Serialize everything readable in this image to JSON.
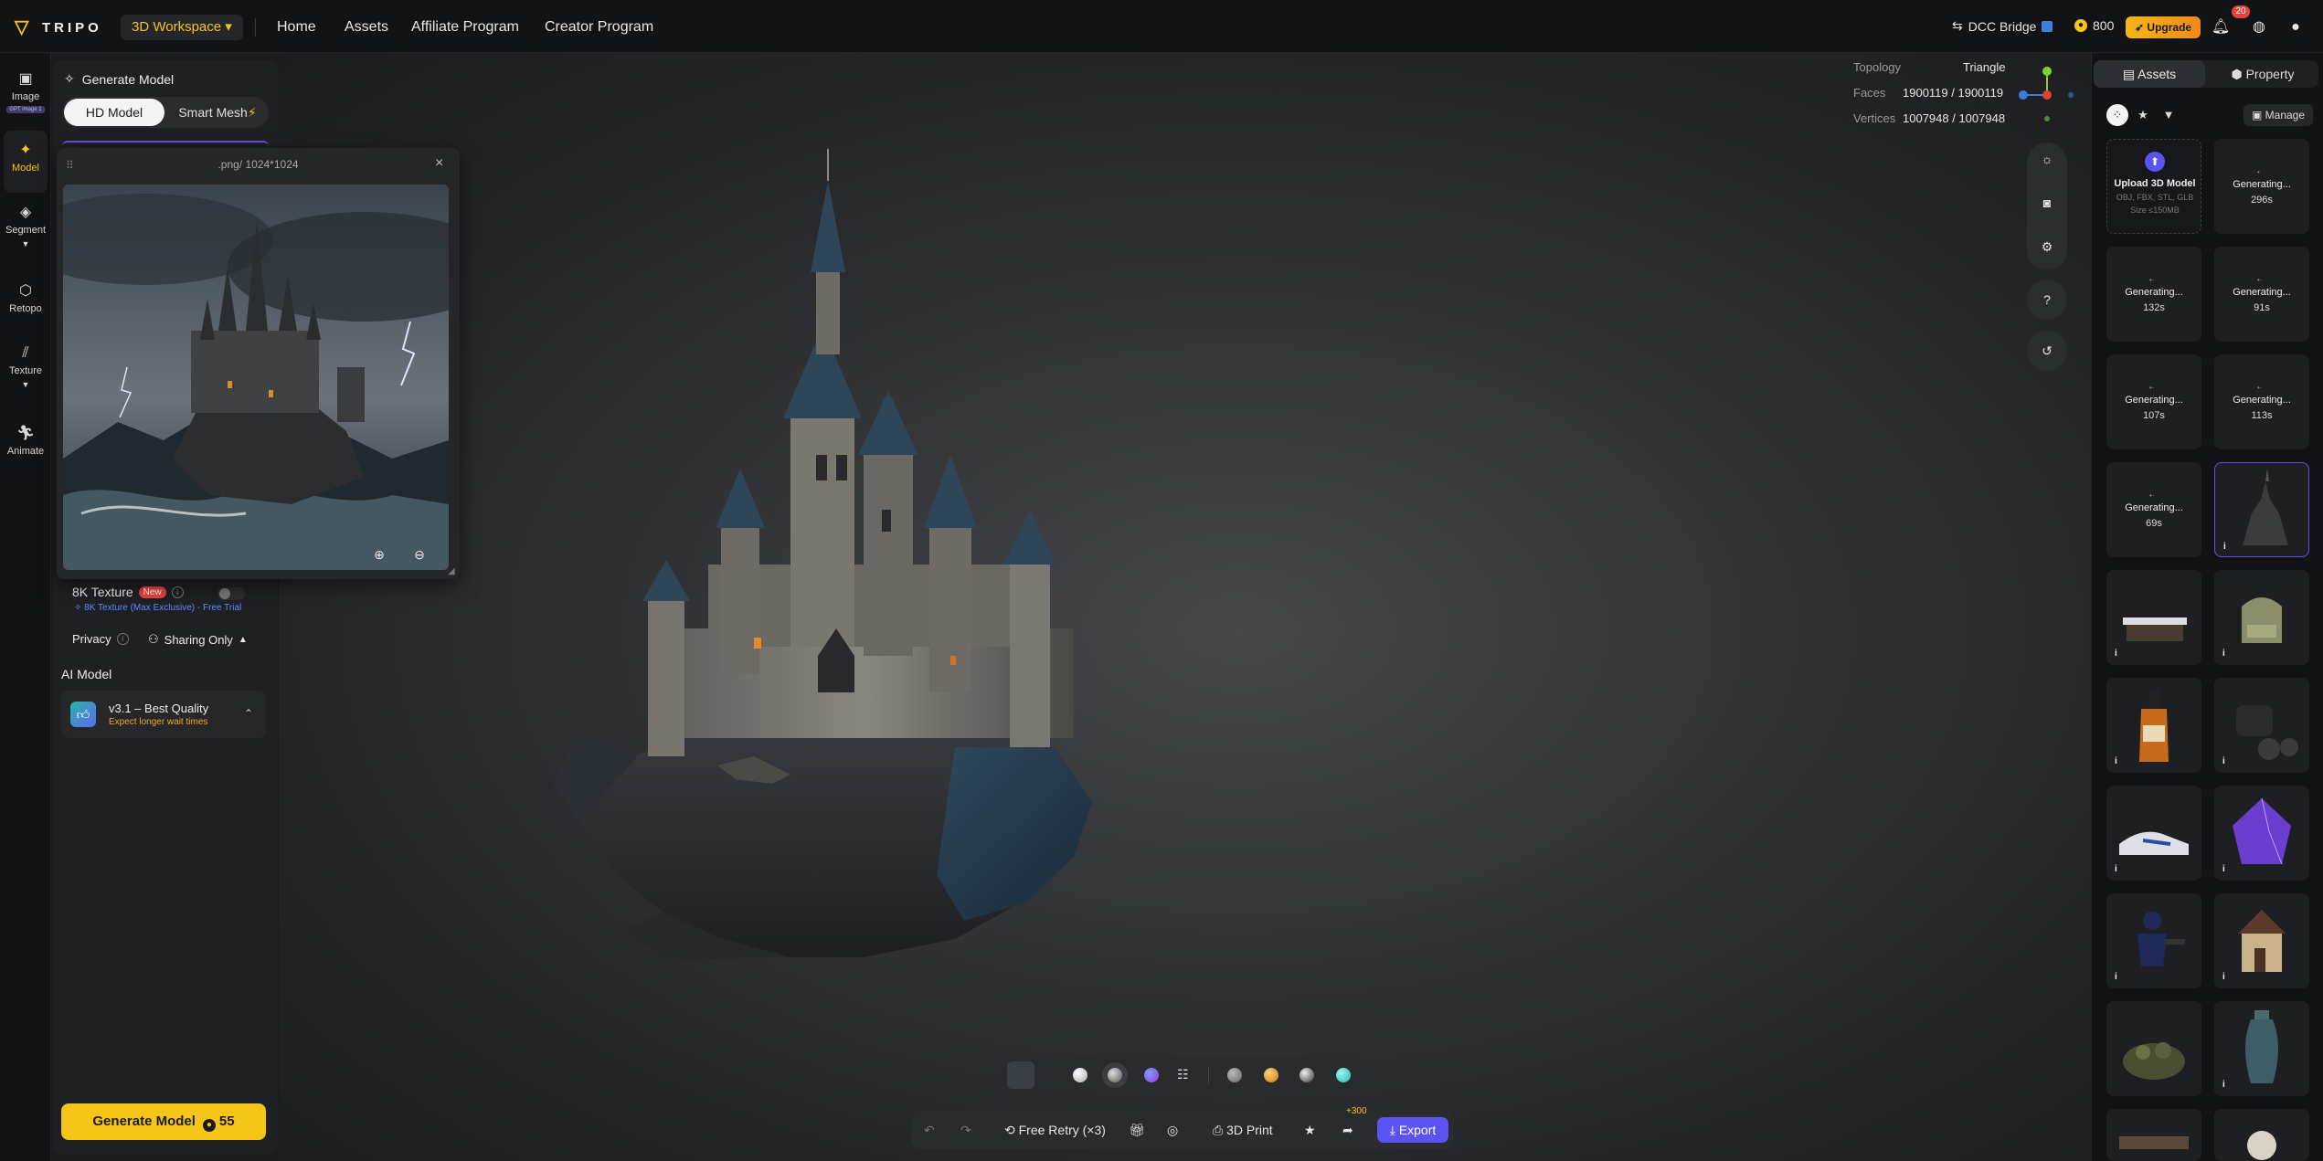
{
  "app": {
    "logo_text": "TRIPO",
    "workspace_label": "3D Workspace",
    "nav": [
      "Home",
      "Assets",
      "Affiliate Program",
      "Creator Program"
    ],
    "dcc_bridge": "DCC Bridge",
    "credits": "800",
    "upgrade": "Upgrade",
    "notification_count": "20"
  },
  "rail": {
    "image": "Image",
    "image_badge": "GPT image 1",
    "model": "Model",
    "segment": "Segment",
    "retopo": "Retopo",
    "texture": "Texture",
    "animate": "Animate"
  },
  "panel": {
    "title": "Generate Model",
    "tab_hd": "HD Model",
    "tab_smart": "Smart Mesh",
    "texture_8k": "8K Texture",
    "new_badge": "New",
    "texture_8k_sub": "8K Texture (Max Exclusive) - Free Trial",
    "privacy": "Privacy",
    "sharing": "Sharing Only",
    "ai_model_title": "AI Model",
    "ai_model_name": "v3.1 – Best Quality",
    "ai_model_sub": "Expect longer wait times",
    "generate_label": "Generate Model",
    "generate_cost": "55"
  },
  "popup": {
    "title": ".png/ 1024*1024"
  },
  "stats": {
    "topology_label": "Topology",
    "topology_value": "Triangle",
    "faces_label": "Faces",
    "faces_value": "1900119 / 1900119",
    "vertices_label": "Vertices",
    "vertices_value": "1007948 / 1007948"
  },
  "toolbar": {
    "free_retry": "Free Retry (×3)",
    "print": "3D Print",
    "export": "Export",
    "export_bonus": "+300"
  },
  "right": {
    "tab_assets": "Assets",
    "tab_property": "Property",
    "manage": "Manage",
    "upload_title": "Upload 3D Model",
    "upload_formats": "OBJ, FBX, STL, GLB",
    "upload_size": "Size ≤150MB",
    "generating_label": "Generating...",
    "jobs": [
      "296s",
      "132s",
      "91s",
      "107s",
      "113s",
      "69s"
    ]
  },
  "colors": {
    "accent": "#f5c518",
    "brand_purple": "#5b53f0",
    "background": "#1b1c1e",
    "panel": "#1f2023"
  }
}
